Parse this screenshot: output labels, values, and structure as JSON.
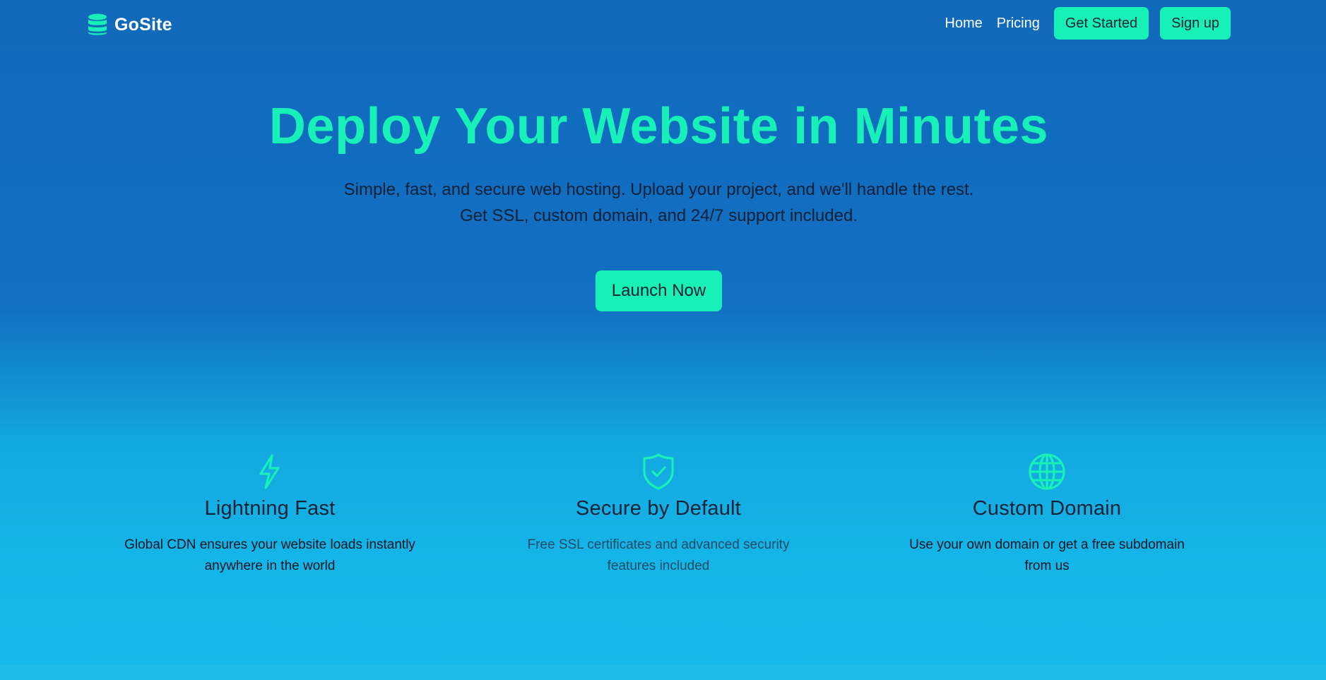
{
  "header": {
    "brand": "GoSite",
    "logo_icon": "database-icon",
    "nav": {
      "home": "Home",
      "pricing": "Pricing",
      "get_started": "Get Started",
      "sign_up": "Sign up"
    }
  },
  "hero": {
    "title": "Deploy Your Website in Minutes",
    "subtitle_line1": "Simple, fast, and secure web hosting. Upload your project, and we'll handle the rest.",
    "subtitle_line2": "Get SSL, custom domain, and 24/7 support included.",
    "cta": "Launch Now"
  },
  "features": [
    {
      "icon": "lightning-icon",
      "title": "Lightning Fast",
      "desc_line1": "Global CDN ensures your website loads instantly",
      "desc_line2": "anywhere in the world"
    },
    {
      "icon": "shield-check-icon",
      "title": "Secure by Default",
      "desc_line1": "Free SSL certificates and advanced security",
      "desc_line2": "features included"
    },
    {
      "icon": "globe-icon",
      "title": "Custom Domain",
      "desc_line1": "Use your own domain or get a free subdomain",
      "desc_line2": "from us"
    }
  ],
  "colors": {
    "accent": "#17f0b6",
    "header_bg": "#1168ba",
    "bottom_bg": "#15b9ea",
    "text_dark": "#112234"
  }
}
